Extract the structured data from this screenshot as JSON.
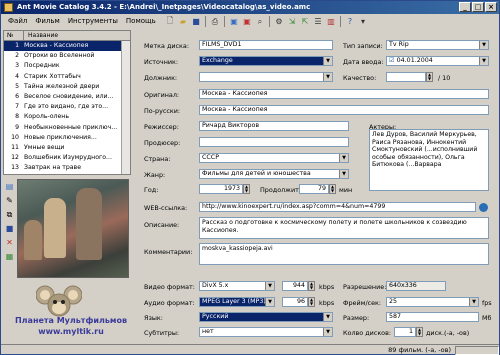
{
  "window": {
    "title": "Ant Movie Catalog 3.4.2 - E:\\Andrei\\_Inetpages\\Videocatalog\\as_video.amc"
  },
  "menu": [
    "Файл",
    "Фильм",
    "Инструменты",
    "Помощь"
  ],
  "toolbar_icons": [
    "new-file-icon",
    "open-folder-icon",
    "save-icon",
    "print-icon",
    "add-movie-icon",
    "remove-movie-icon",
    "search-icon",
    "settings-icon",
    "import-icon",
    "export-icon",
    "scripts-icon",
    "statistics-icon",
    "help-icon",
    "language-icon"
  ],
  "list": {
    "headers": {
      "num": "№",
      "name": "Название"
    },
    "rows": [
      {
        "num": "1",
        "name": "Москва - Кассиопея",
        "selected": true
      },
      {
        "num": "2",
        "name": "Отроки во Вселенной"
      },
      {
        "num": "3",
        "name": "Посредник"
      },
      {
        "num": "4",
        "name": "Старик Хоттабыч"
      },
      {
        "num": "5",
        "name": "Тайна железной двери"
      },
      {
        "num": "6",
        "name": "Веселое сновидение, или..."
      },
      {
        "num": "7",
        "name": "Где это видано, где это..."
      },
      {
        "num": "8",
        "name": "Король-олень"
      },
      {
        "num": "9",
        "name": "Необыкновенные приключ..."
      },
      {
        "num": "10",
        "name": "Новые приключения..."
      },
      {
        "num": "11",
        "name": "Умные вещи"
      },
      {
        "num": "12",
        "name": "Волшебник Изумрудного..."
      },
      {
        "num": "13",
        "name": "Завтрак на траве"
      }
    ]
  },
  "side_tools": [
    "load-picture-icon",
    "paste-picture-icon",
    "copy-picture-icon",
    "save-picture-icon",
    "delete-picture-icon",
    "picture-info-icon"
  ],
  "logo": {
    "title": "Планета Мультфильмов",
    "url": "www.myltik.ru"
  },
  "form": {
    "media_label": "Метка диска:",
    "media_value": "FILMS_DVD1",
    "type_label": "Тип записи:",
    "type_value": "Tv Rip",
    "source_label": "Источник:",
    "source_value": "Exchange",
    "date_label": "Дата ввода:",
    "date_value": "04.01.2004",
    "borrower_label": "Должник:",
    "borrower_value": "",
    "rating_label": "Качество:",
    "rating_value": "",
    "rating_max": "/ 10",
    "original_label": "Оригинал:",
    "original_value": "Москва - Кассиопея",
    "translated_label": "По-русски:",
    "translated_value": "Москва - Кассиопея",
    "director_label": "Режиссер:",
    "director_value": "Ричард Викторов",
    "producer_label": "Продюсер:",
    "producer_value": "",
    "actors_label": "Актеры:",
    "actors_value": "Лев Дуров, Василий Меркурьев, Раиса Рязанова, Иннокентий Смоктуновский (...исполнивший особые обязанности), Ольга Битюкова (...Варвара",
    "country_label": "Страна:",
    "country_value": "СССР",
    "genre_label": "Жанр:",
    "genre_value": "Фильмы для детей и юношества",
    "year_label": "Год:",
    "year_value": "1973",
    "length_label": "Продолжит.:",
    "length_value": "79",
    "length_unit": "мин",
    "url_label": "WEB-ссылка:",
    "url_value": "http://www.kinoexpert.ru/index.asp?comm=4&num=4799",
    "description_label": "Описание:",
    "description_value": "Рассказ о подготовке к космическому полету и полете школьников к созвездию Кассиопея.",
    "comments_label": "Комментарии:",
    "comments_value": "moskva_kassiopeja.avi",
    "video_label": "Видео формат:",
    "video_value": "DivX 5.x",
    "video_bitrate": "944",
    "kbps": "kbps",
    "audio_label": "Аудио формат:",
    "audio_value": "MPEG Layer 3 (MP3)",
    "audio_bitrate": "96",
    "language_label": "Язык:",
    "language_value": "Русский",
    "subtitles_label": "Субтитры:",
    "subtitles_value": "нет",
    "resolution_label": "Разрешение:",
    "resolution_value": "640x336",
    "framerate_label": "Фрейм/сек:",
    "framerate_value": "25",
    "fps": "fps",
    "size_label": "Размер:",
    "size_value": "587",
    "size_unit": "Мб",
    "discs_label": "Колво дисков:",
    "discs_value": "1",
    "discs_unit": "диск.(-а, -ов)"
  },
  "status": {
    "text": "89 фильм. (-а, -ов)"
  },
  "colors": {
    "selection": "#0a246a",
    "titlebar": "#0a246a",
    "window": "#d4d0c8",
    "logo_text": "#3a3a9a"
  }
}
